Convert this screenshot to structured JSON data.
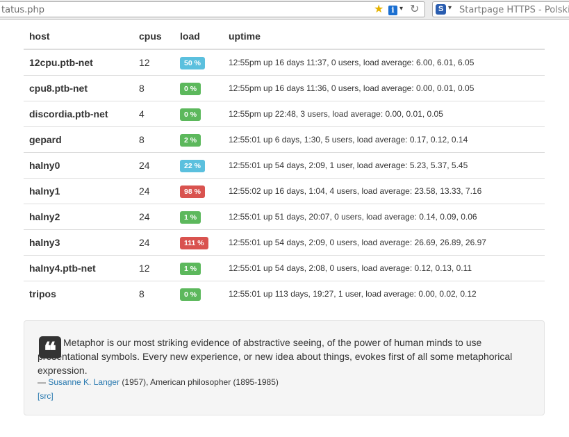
{
  "browser": {
    "url": "tatus.php",
    "search_placeholder": "Startpage HTTPS - Polski",
    "engine_icon_glyph": "S"
  },
  "table": {
    "headers": {
      "host": "host",
      "cpus": "cpus",
      "load": "load",
      "uptime": "uptime"
    },
    "rows": [
      {
        "host": "12cpu.ptb-net",
        "cpus": "12",
        "load": "50 %",
        "load_status": "info",
        "uptime": "12:55pm up 16 days 11:37, 0 users, load average: 6.00, 6.01, 6.05"
      },
      {
        "host": "cpu8.ptb-net",
        "cpus": "8",
        "load": "0 %",
        "load_status": "success",
        "uptime": "12:55pm up 16 days 11:36, 0 users, load average: 0.00, 0.01, 0.05"
      },
      {
        "host": "discordia.ptb-net",
        "cpus": "4",
        "load": "0 %",
        "load_status": "success",
        "uptime": "12:55pm up 22:48, 3 users, load average: 0.00, 0.01, 0.05"
      },
      {
        "host": "gepard",
        "cpus": "8",
        "load": "2 %",
        "load_status": "success",
        "uptime": "12:55:01 up 6 days, 1:30, 5 users, load average: 0.17, 0.12, 0.14"
      },
      {
        "host": "halny0",
        "cpus": "24",
        "load": "22 %",
        "load_status": "info",
        "uptime": "12:55:01 up 54 days, 2:09, 1 user, load average: 5.23, 5.37, 5.45"
      },
      {
        "host": "halny1",
        "cpus": "24",
        "load": "98 %",
        "load_status": "danger",
        "uptime": "12:55:02 up 16 days, 1:04, 4 users, load average: 23.58, 13.33, 7.16"
      },
      {
        "host": "halny2",
        "cpus": "24",
        "load": "1 %",
        "load_status": "success",
        "uptime": "12:55:01 up 51 days, 20:07, 0 users, load average: 0.14, 0.09, 0.06"
      },
      {
        "host": "halny3",
        "cpus": "24",
        "load": "111 %",
        "load_status": "danger",
        "uptime": "12:55:01 up 54 days, 2:09, 0 users, load average: 26.69, 26.89, 26.97"
      },
      {
        "host": "halny4.ptb-net",
        "cpus": "12",
        "load": "1 %",
        "load_status": "success",
        "uptime": "12:55:01 up 54 days, 2:08, 0 users, load average: 0.12, 0.13, 0.11"
      },
      {
        "host": "tripos",
        "cpus": "8",
        "load": "0 %",
        "load_status": "success",
        "uptime": "12:55:01 up 113 days, 19:27, 1 user, load average: 0.00, 0.02, 0.12"
      }
    ]
  },
  "colors": {
    "success": "#5cb85c",
    "info": "#5bc0de",
    "danger": "#d9534f"
  },
  "quote": {
    "text": "Metaphor is our most striking evidence of abstractive seeing, of the power of human minds to use presentational symbols. Every new experience, or new idea about things, evokes first of all some metaphorical expression.",
    "dash": "— ",
    "author": "Susanne K. Langer",
    "details": " (1957), American philosopher (1895-1985)",
    "src_label": "[src]"
  }
}
